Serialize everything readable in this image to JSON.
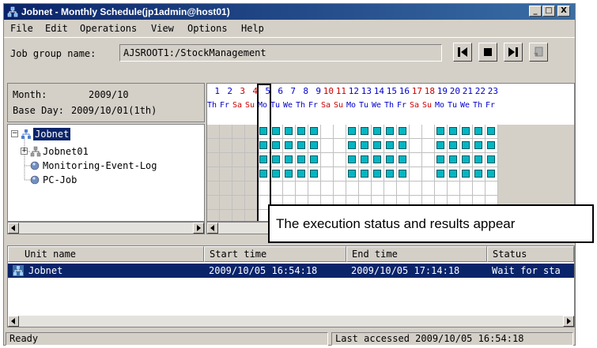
{
  "window": {
    "title": "Jobnet - Monthly Schedule(jp1admin@host01)",
    "minimize_glyph": "_",
    "maximize_glyph": "□",
    "close_glyph": "X"
  },
  "menu": [
    "File",
    "Edit",
    "Operations",
    "View",
    "Options",
    "Help"
  ],
  "jobgroup": {
    "label": "Job group name:",
    "value": "AJSROOT1:/StockManagement"
  },
  "info": {
    "month_label": "Month:",
    "month_value": "2009/10",
    "base_day_label": "Base Day:",
    "base_day_value": "2009/10/01(1th)"
  },
  "tree": {
    "items": [
      {
        "label": "Jobnet",
        "icon": "jobnet-root-icon",
        "selected": true
      },
      {
        "label": "Jobnet01",
        "icon": "jobnet-icon",
        "selected": false
      },
      {
        "label": "Monitoring-Event-Log",
        "icon": "event-icon",
        "selected": false
      },
      {
        "label": "PC-Job",
        "icon": "job-icon",
        "selected": false
      }
    ]
  },
  "calendar": {
    "days": [
      {
        "num": "1",
        "wd": "Th"
      },
      {
        "num": "2",
        "wd": "Fr"
      },
      {
        "num": "3",
        "wd": "Sa"
      },
      {
        "num": "4",
        "wd": "Su"
      },
      {
        "num": "5",
        "wd": "Mo"
      },
      {
        "num": "6",
        "wd": "Tu"
      },
      {
        "num": "7",
        "wd": "We"
      },
      {
        "num": "8",
        "wd": "Th"
      },
      {
        "num": "9",
        "wd": "Fr"
      },
      {
        "num": "10",
        "wd": "Sa"
      },
      {
        "num": "11",
        "wd": "Su"
      },
      {
        "num": "12",
        "wd": "Mo"
      },
      {
        "num": "13",
        "wd": "Tu"
      },
      {
        "num": "14",
        "wd": "We"
      },
      {
        "num": "15",
        "wd": "Th"
      },
      {
        "num": "16",
        "wd": "Fr"
      },
      {
        "num": "17",
        "wd": "Sa"
      },
      {
        "num": "18",
        "wd": "Su"
      },
      {
        "num": "19",
        "wd": "Mo"
      },
      {
        "num": "20",
        "wd": "Tu"
      },
      {
        "num": "21",
        "wd": "We"
      },
      {
        "num": "22",
        "wd": "Th"
      },
      {
        "num": "23",
        "wd": "Fr"
      }
    ],
    "today_index": 4,
    "weekday_color": "#0000cc",
    "weekend_color": "#cc0000",
    "mark_color": "#00b7c3",
    "rows": 4
  },
  "callout": "The execution status and results appear",
  "list": {
    "columns": [
      "Unit name",
      "Start time",
      "End time",
      "Status"
    ],
    "rows": [
      {
        "unit_name": "Jobnet",
        "start_time": "2009/10/05 16:54:18",
        "end_time": "2009/10/05 17:14:18",
        "status": "Wait for sta"
      }
    ]
  },
  "status": {
    "left": "Ready",
    "right": "Last accessed 2009/10/05 16:54:18"
  }
}
